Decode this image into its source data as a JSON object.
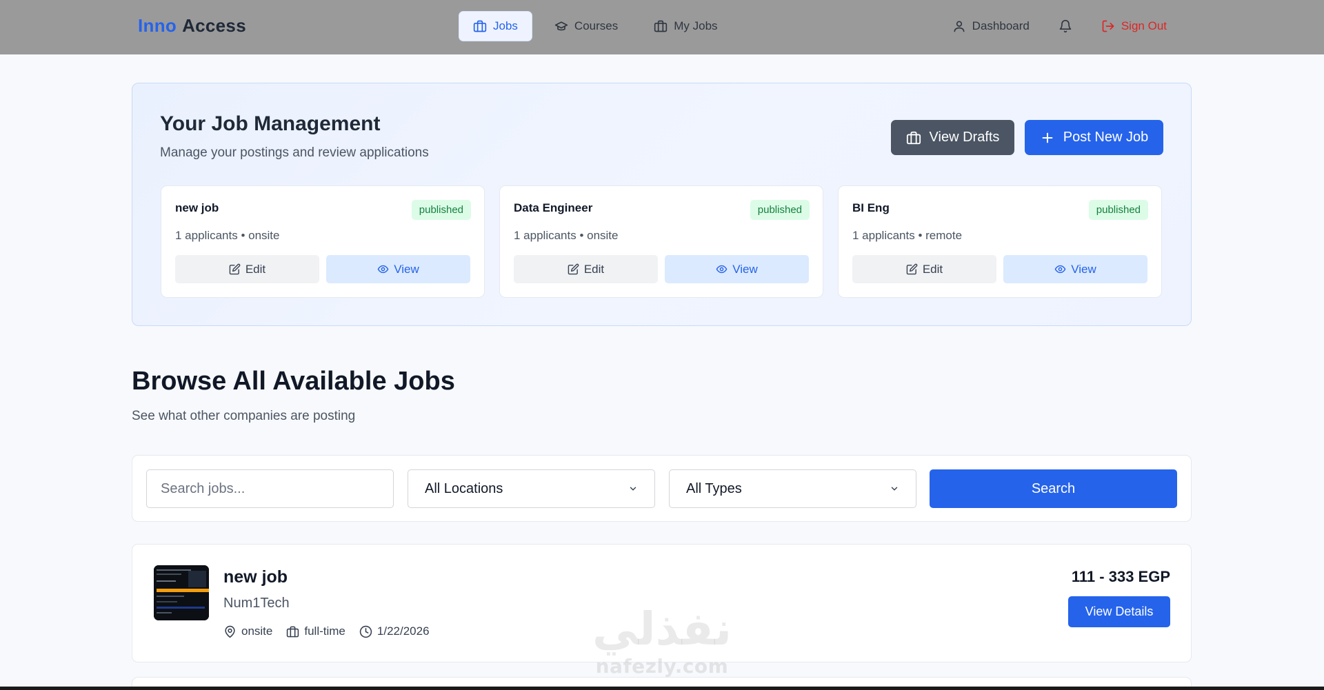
{
  "brand": {
    "part1": "Inno",
    "part2": "Access"
  },
  "nav": {
    "center": [
      {
        "label": "Jobs",
        "icon": "briefcase-icon",
        "active": true
      },
      {
        "label": "Courses",
        "icon": "graduation-cap-icon",
        "active": false
      },
      {
        "label": "My Jobs",
        "icon": "briefcase-icon",
        "active": false
      }
    ],
    "dashboard": "Dashboard",
    "signout": "Sign Out"
  },
  "management": {
    "title": "Your Job Management",
    "subtitle": "Manage your postings and review applications",
    "view_drafts": "View Drafts",
    "post_new": "Post New Job",
    "cards": [
      {
        "title": "new job",
        "status": "published",
        "meta": "1 applicants • onsite",
        "edit": "Edit",
        "view": "View"
      },
      {
        "title": "Data Engineer",
        "status": "published",
        "meta": "1 applicants • onsite",
        "edit": "Edit",
        "view": "View"
      },
      {
        "title": "BI Eng",
        "status": "published",
        "meta": "1 applicants • remote",
        "edit": "Edit",
        "view": "View"
      }
    ]
  },
  "browse": {
    "title": "Browse All Available Jobs",
    "subtitle": "See what other companies are posting"
  },
  "filters": {
    "search_placeholder": "Search jobs...",
    "location": "All Locations",
    "type": "All Types",
    "search_button": "Search"
  },
  "listings": [
    {
      "title": "new job",
      "company": "Num1Tech",
      "location": "onsite",
      "type": "full-time",
      "date": "1/22/2026",
      "salary": "111 - 333 EGP",
      "details": "View Details"
    }
  ],
  "watermark": {
    "arabic": "نفذلي",
    "latin": "nafezly.com"
  },
  "colors": {
    "primary": "#2563eb",
    "success_bg": "#dcfce7",
    "success_text": "#15803d",
    "danger": "#dc2626",
    "topbar": "#9a9a9a"
  }
}
